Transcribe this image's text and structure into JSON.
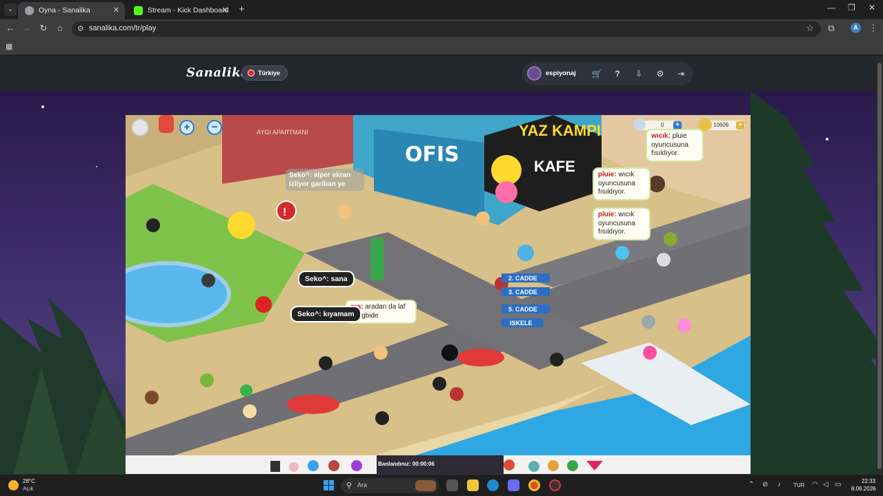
{
  "browser": {
    "tabs": [
      {
        "title": "Oyna - Sanalika",
        "active": true
      },
      {
        "title": "Stream - Kick Dashboard",
        "active": false
      }
    ],
    "new_tab": "+",
    "address": "sanalika.com/tr/play",
    "profile_initial": "A"
  },
  "site": {
    "logo": "Sanalika",
    "country": "Türkiye",
    "username": "espiyonaj",
    "colors": {
      "header_bg": "#22262d",
      "accent_red": "#e3262e"
    }
  },
  "game": {
    "currency": {
      "silver": "0",
      "gold": "10609"
    },
    "buildings": {
      "office": "OFIS",
      "cafe": "KAFE",
      "camp": "YAZ KAMPI",
      "apartment": "AYGI APARTMANI"
    },
    "street_signs": [
      "2. CADDE",
      "3. CADDE",
      "5. CADDE",
      "ISKELE"
    ],
    "bubbles": [
      {
        "who": "wıcık:",
        "text": "pluie oyuncusuna fısıldıyor."
      },
      {
        "who": "pluie:",
        "text": "wıcık oyuncusuna fısıldıyor."
      },
      {
        "who": "pluie:",
        "text": "wıcık oyuncusuna fısıldıyor."
      },
      {
        "who": "era:",
        "text": "aradan da laf etti gbide"
      }
    ],
    "faded_bubble": "Seko^: alper ekran izliyor gariban ye",
    "dark_bubbles": [
      "Seko^: sana",
      "Seko^: kıyamam"
    ],
    "ban_status": "Banlandınız: 00:00:06"
  },
  "taskbar": {
    "temperature": "28°C",
    "weather": "Açık",
    "search_placeholder": "Ara",
    "language": "TUR",
    "time": "22:33",
    "date": "8.06.2026"
  }
}
